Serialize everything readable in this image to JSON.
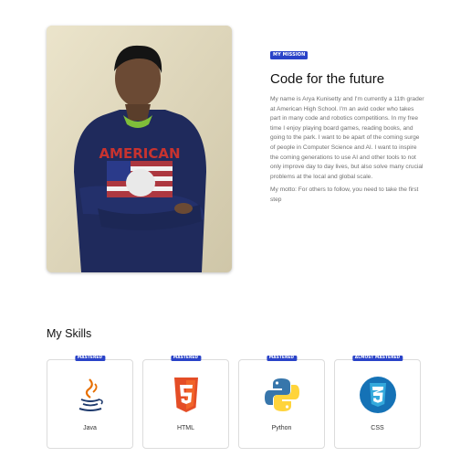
{
  "mission": {
    "badge": "MY MISSION",
    "title": "Code for the future",
    "body": "My name is Arya Kunisetty and I'm currently a 11th grader at American High School. I'm an avid coder who takes part in many code and robotics competitions. In my free time I enjoy playing board games, reading books, and going to the park. I want to be apart of the coming surge of people in Computer Science and AI. I want to inspire the coming generations to use AI and other tools to not only improve day to day lives, but also solve many crucial problems at the local and global scale.",
    "motto": "My motto: For others to follow, you need to take the first step"
  },
  "photo": {
    "shirt_text": "AMERICAN"
  },
  "skills": {
    "heading": "My Skills",
    "items": [
      {
        "name": "Java",
        "badge": "MASTERED",
        "icon": "java-icon"
      },
      {
        "name": "HTML",
        "badge": "MASTERED",
        "icon": "html5-icon"
      },
      {
        "name": "Python",
        "badge": "MASTERED",
        "icon": "python-icon"
      },
      {
        "name": "CSS",
        "badge": "ALMOST MASTERED",
        "icon": "css3-icon"
      }
    ]
  },
  "colors": {
    "badge": "#2a43c8",
    "hoodie": "#1f2a5c",
    "html": "#e44d26",
    "css": "#1572b6",
    "python_blue": "#3776ab",
    "python_yellow": "#ffd43b"
  }
}
